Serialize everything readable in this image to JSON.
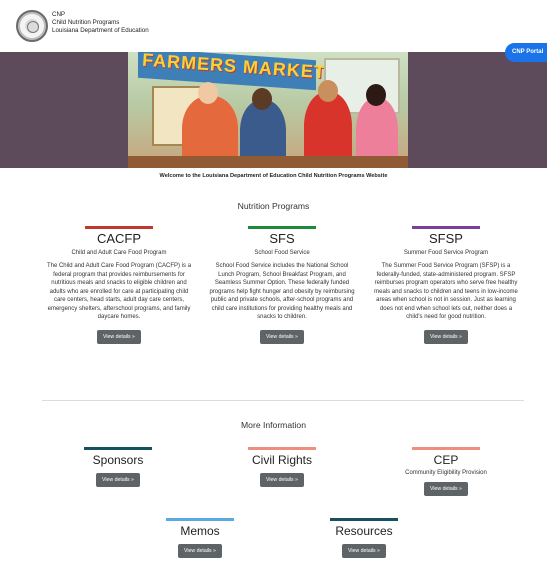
{
  "header": {
    "brand_line1": "CNP",
    "brand_line2": "Child Nutrition Programs",
    "brand_line3": "Louisiana Department of Education",
    "portal_button": "CNP Portal",
    "seal_icon": "louisiana-seal-icon"
  },
  "hero": {
    "banner_text": "FARMERS MARKET",
    "welcome": "Welcome to the Louisiana Department of Education Child Nutrition Programs Website"
  },
  "programs": {
    "heading": "Nutrition Programs",
    "items": [
      {
        "title": "CACFP",
        "subtitle": "Child and Adult Care Food Program",
        "description": "The Child and Adult Care Food Program (CACFP) is a federal program that provides reimbursements for nutritious meals and snacks to eligible children and adults who are enrolled for care at participating child care centers, head starts, adult day care centers, emergency shelters, afterschool programs, and family daycare homes.",
        "button": "View details »",
        "color": "#c0392b"
      },
      {
        "title": "SFS",
        "subtitle": "School Food Service",
        "description": "School Food Service includes the National School Lunch Program, School Breakfast Program, and Seamless Summer Option. These federally funded programs help fight hunger and obesity by reimbursing public and private schools, after-school programs and child care institutions for providing healthy meals and snacks to children.",
        "button": "View details »",
        "color": "#1e8a3c"
      },
      {
        "title": "SFSP",
        "subtitle": "Summer Food Service Program",
        "description": "The Summer Food Service Program (SFSP) is a federally-funded, state-administered program. SFSP reimburses program operators who serve free healthy meals and snacks to children and teens in low-income areas when school is not in session. Just as learning does not end when school lets out, neither does a child's need for good nutrition.",
        "button": "View details »",
        "color": "#7b3fa0"
      }
    ]
  },
  "more_info": {
    "heading": "More Information",
    "items": [
      {
        "title": "Sponsors",
        "subtitle": "",
        "button": "View details »",
        "color": "#17505e"
      },
      {
        "title": "Civil Rights",
        "subtitle": "",
        "button": "View details »",
        "color": "#f08e7e"
      },
      {
        "title": "CEP",
        "subtitle": "Community Eligibility Provision",
        "button": "View details »",
        "color": "#f08e7e"
      },
      {
        "title": "Memos",
        "subtitle": "",
        "button": "View details »",
        "color": "#5aa9e0"
      },
      {
        "title": "Resources",
        "subtitle": "",
        "button": "View details »",
        "color": "#17505e"
      }
    ]
  }
}
